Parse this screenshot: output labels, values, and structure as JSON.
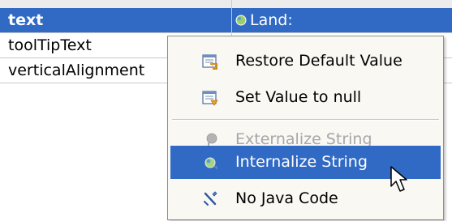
{
  "properties": {
    "rows": [
      {
        "name": "text",
        "value": "Land:"
      },
      {
        "name": "toolTipText",
        "value": ""
      },
      {
        "name": "verticalAlignment",
        "value": ""
      }
    ]
  },
  "context_menu": {
    "items": [
      {
        "label": "Restore Default Value",
        "icon": "restore-default-icon",
        "enabled": true
      },
      {
        "label": "Set Value to null",
        "icon": "set-null-icon",
        "enabled": true
      },
      {
        "label": "Externalize String",
        "icon": "externalize-string-icon",
        "enabled": false
      },
      {
        "label": "Internalize String",
        "icon": "internalize-string-icon",
        "enabled": true,
        "highlighted": true
      },
      {
        "label": "No Java Code",
        "icon": "no-java-code-icon",
        "enabled": true
      }
    ]
  },
  "colors": {
    "selection": "#316ac5",
    "menu_background": "#f9f8f3",
    "disabled_text": "#a7a6aa"
  }
}
